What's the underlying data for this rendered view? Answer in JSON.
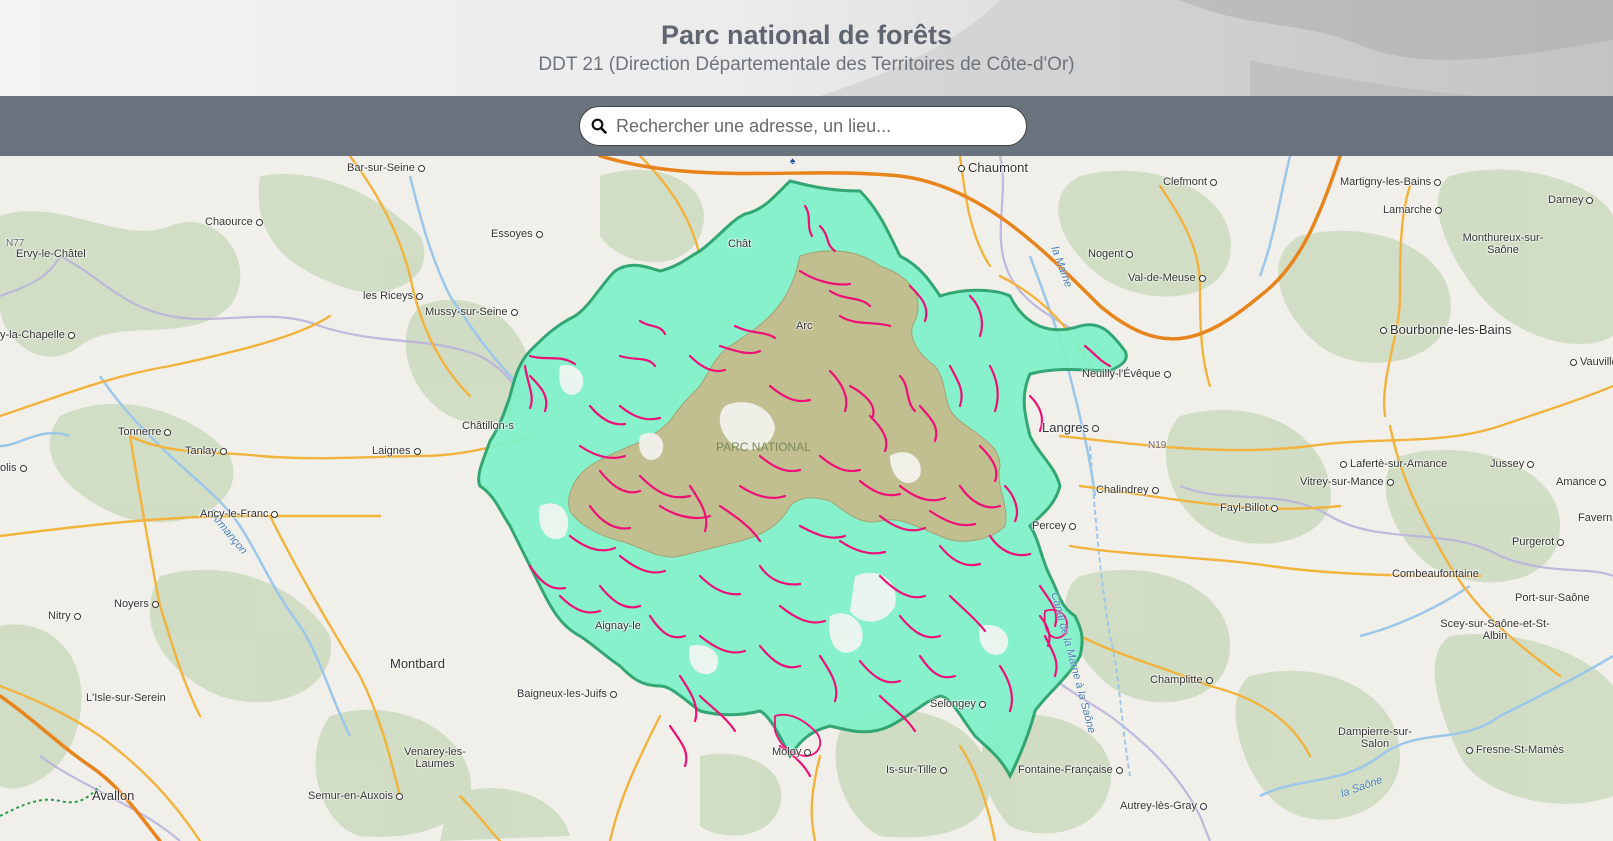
{
  "header": {
    "title": "Parc national de forêts",
    "subtitle": "DDT 21 (Direction Départementale des Territoires de Côte-d'Or)"
  },
  "search": {
    "placeholder": "Rechercher une adresse, un lieu...",
    "icon": "search-icon"
  },
  "map": {
    "park_label": "PARC NATIONAL",
    "colors": {
      "park_fill": "#7df2c9",
      "park_border": "#25a06a",
      "heart_fill": "#c8b98a",
      "forest_patches": "#ee0f77",
      "forest_base": "#cbd9bd",
      "roads": "#f2b33d",
      "motorway": "#e8841c",
      "rivers": "#9cc7ea",
      "boundaries": "#b9b3dc"
    },
    "places": [
      {
        "name": "Bar-sur-Seine"
      },
      {
        "name": "Chaumont"
      },
      {
        "name": "Clefmont"
      },
      {
        "name": "Martigny-les-Bains"
      },
      {
        "name": "Darney"
      },
      {
        "name": "Lamarche"
      },
      {
        "name": "Chaource"
      },
      {
        "name": "Essoyes"
      },
      {
        "name": "Ervy-le-Châtel"
      },
      {
        "name": "Nogent"
      },
      {
        "name": "Monthureux-sur-Saône"
      },
      {
        "name": "Val-de-Meuse"
      },
      {
        "name": "les Riceys"
      },
      {
        "name": "Mussy-sur-Seine"
      },
      {
        "name": "y-la-Chapelle"
      },
      {
        "name": "Bourbonne-les-Bains"
      },
      {
        "name": "Vauville"
      },
      {
        "name": "Neuilly-l'Évêque"
      },
      {
        "name": "Tonnerre"
      },
      {
        "name": "Châtillon-s"
      },
      {
        "name": "Langres"
      },
      {
        "name": "olis"
      },
      {
        "name": "Tanlay"
      },
      {
        "name": "Laignes"
      },
      {
        "name": "Lafertè-sur-Amance"
      },
      {
        "name": "Jussey"
      },
      {
        "name": "Chalindrey"
      },
      {
        "name": "Vitrey-sur-Mance"
      },
      {
        "name": "Amance"
      },
      {
        "name": "Ancy-le-Franc"
      },
      {
        "name": "Fayl-Billot"
      },
      {
        "name": "Favern"
      },
      {
        "name": "Percey"
      },
      {
        "name": "Purgerot"
      },
      {
        "name": "Combeaufontaine"
      },
      {
        "name": "Noyers"
      },
      {
        "name": "Nitry"
      },
      {
        "name": "Port-sur-Saône"
      },
      {
        "name": "Aignay-le"
      },
      {
        "name": "Scey-sur-Saône-et-St-Albin"
      },
      {
        "name": "Montbard"
      },
      {
        "name": "Champlitte"
      },
      {
        "name": "L'Isle-sur-Serein"
      },
      {
        "name": "Baigneux-les-Juifs"
      },
      {
        "name": "Selongey"
      },
      {
        "name": "Dampierre-sur-Salon"
      },
      {
        "name": "Fresne-St-Mamès"
      },
      {
        "name": "Venarey-les-Laumes"
      },
      {
        "name": "Moloy"
      },
      {
        "name": "Is-sur-Tille"
      },
      {
        "name": "Fontaine-Française"
      },
      {
        "name": "Avallon"
      },
      {
        "name": "Semur-en-Auxois"
      },
      {
        "name": "Autrey-lès-Gray"
      },
      {
        "name": "Arc"
      },
      {
        "name": "Chât"
      }
    ],
    "road_labels": [
      "N77",
      "N19"
    ],
    "river_labels": [
      "la Marne",
      "Canal de la Marne à la Saône",
      "l'Armançon",
      "la Saône"
    ]
  }
}
